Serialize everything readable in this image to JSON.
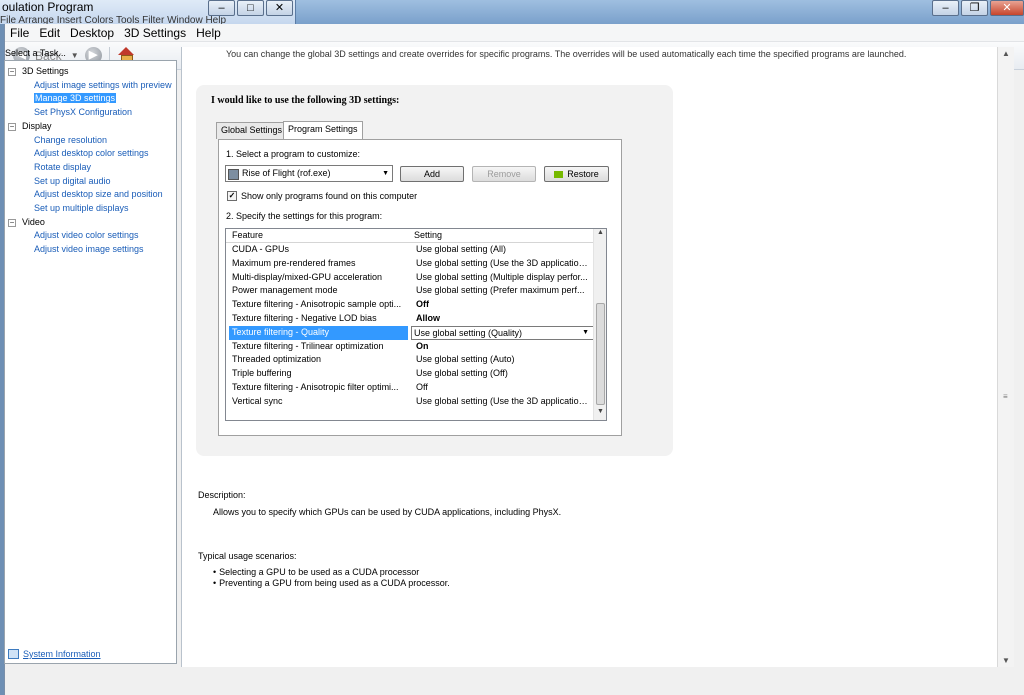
{
  "background_window": {
    "title": "oulation Program",
    "menu_fragment": "File   Arrange   Insert   Colors   Tools   Filter   Window   Help"
  },
  "main_window": {
    "menu": [
      "File",
      "Edit",
      "Desktop",
      "3D Settings",
      "Help"
    ],
    "toolbar": {
      "back_label": "Back",
      "back_icon": "back-arrow-icon",
      "forward_icon": "forward-arrow-icon",
      "home_icon": "home-icon"
    }
  },
  "task_pane": {
    "caption": "Select a Task...",
    "categories": [
      {
        "label": "3D Settings",
        "items": [
          "Adjust image settings with preview",
          "Manage 3D settings",
          "Set PhysX Configuration"
        ]
      },
      {
        "label": "Display",
        "items": [
          "Change resolution",
          "Adjust desktop color settings",
          "Rotate display",
          "Set up digital audio",
          "Adjust desktop size and position",
          "Set up multiple displays"
        ]
      },
      {
        "label": "Video",
        "items": [
          "Adjust video color settings",
          "Adjust video image settings"
        ]
      }
    ],
    "selected_item": "Manage 3D settings",
    "system_information": "System Information"
  },
  "content": {
    "intro": "You can change the global 3D settings and create overrides for specific programs. The overrides will be used automatically each time the specified programs are launched.",
    "heading": "I would like to use the following 3D settings:",
    "tabs": [
      "Global Settings",
      "Program Settings"
    ],
    "active_tab": "Program Settings",
    "step1": "1. Select a program to customize:",
    "program": "Rise of Flight (rof.exe)",
    "buttons": {
      "add": "Add",
      "remove": "Remove",
      "restore": "Restore"
    },
    "checkbox_label": "Show only programs found on this computer",
    "checkbox_checked": true,
    "step2": "2. Specify the settings for this program:",
    "columns": [
      "Feature",
      "Setting"
    ],
    "rows": [
      {
        "feature": "CUDA - GPUs",
        "setting": "Use global setting (All)"
      },
      {
        "feature": "Maximum pre-rendered frames",
        "setting": "Use global setting (Use the 3D application..."
      },
      {
        "feature": "Multi-display/mixed-GPU acceleration",
        "setting": "Use global setting (Multiple display perfor..."
      },
      {
        "feature": "Power management mode",
        "setting": "Use global setting (Prefer maximum perf..."
      },
      {
        "feature": "Texture filtering - Anisotropic sample opti...",
        "setting": "Off"
      },
      {
        "feature": "Texture filtering - Negative LOD bias",
        "setting": "Allow"
      },
      {
        "feature": "Texture filtering - Quality",
        "setting": "Use global setting (Quality)"
      },
      {
        "feature": "Texture filtering - Trilinear optimization",
        "setting": "On"
      },
      {
        "feature": "Threaded optimization",
        "setting": "Use global setting (Auto)"
      },
      {
        "feature": "Triple buffering",
        "setting": "Use global setting (Off)"
      },
      {
        "feature": "Texture filtering - Anisotropic filter optimi...",
        "setting": "Off"
      },
      {
        "feature": "Vertical sync",
        "setting": "Use global setting (Use the 3D application..."
      }
    ],
    "description_label": "Description:",
    "description": "Allows you to specify which GPUs can be used by CUDA applications, including PhysX.",
    "usage_label": "Typical usage scenarios:",
    "usage": [
      "Selecting a GPU to be used as a CUDA processor",
      "Preventing a GPU from being used as a CUDA processor."
    ]
  }
}
